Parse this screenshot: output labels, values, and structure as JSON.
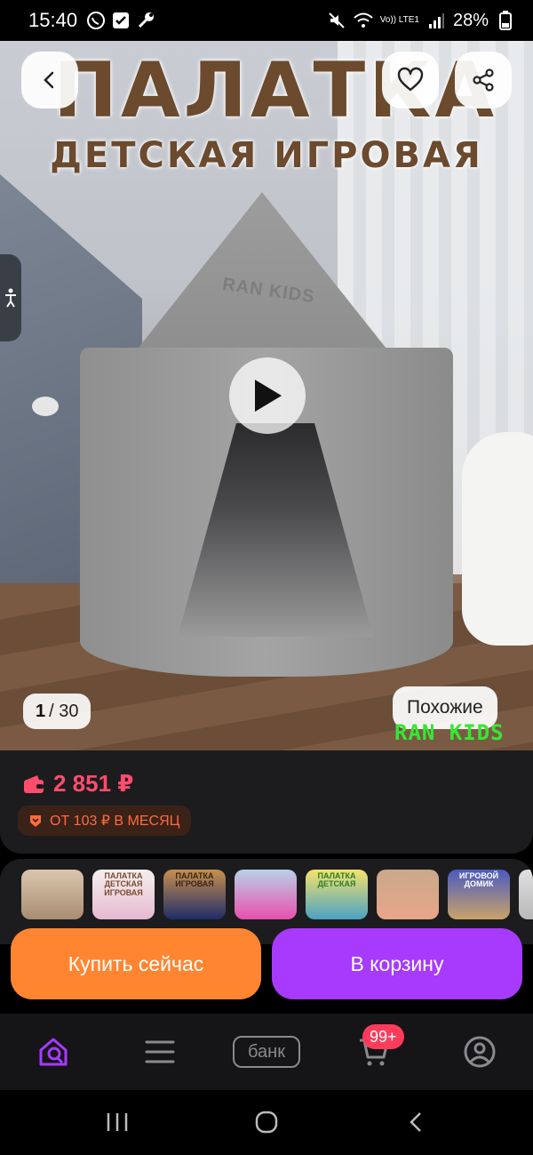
{
  "status_bar": {
    "time": "15:40",
    "battery": "28%",
    "network_label": "Vo)) LTE1"
  },
  "hero": {
    "title_line1": "ПАЛАТКА",
    "title_line2": "ДЕТСКАЯ ИГРОВАЯ",
    "tent_brand": "RAN KIDS",
    "counter_current": "1",
    "counter_total": "/ 30",
    "similar_label": "Похожие",
    "watermark": "RAN KIDS"
  },
  "price": {
    "amount": "2 851 ₽",
    "installment": "ОТ 103 ₽ В МЕСЯЦ"
  },
  "thumbnails": [
    {
      "label": ""
    },
    {
      "label": "ПАЛАТКА ДЕТСКАЯ ИГРОВАЯ"
    },
    {
      "label": "ПАЛАТКА ИГРОВАЯ"
    },
    {
      "label": ""
    },
    {
      "label": "ПАЛАТКА ДЕТСКАЯ"
    },
    {
      "label": ""
    },
    {
      "label": "ИГРОВОЙ ДОМИК"
    },
    {
      "label": ""
    }
  ],
  "actions": {
    "buy_now": "Купить сейчас",
    "add_to_cart": "В корзину"
  },
  "bottom_nav": {
    "bank_label": "банк",
    "cart_badge": "99+"
  },
  "colors": {
    "price": "#ff4d6d",
    "buy_button": "#ff8531",
    "cart_button": "#a73afd",
    "active_nav": "#a73afd",
    "badge": "#ff3b5c",
    "watermark": "#35e834"
  }
}
